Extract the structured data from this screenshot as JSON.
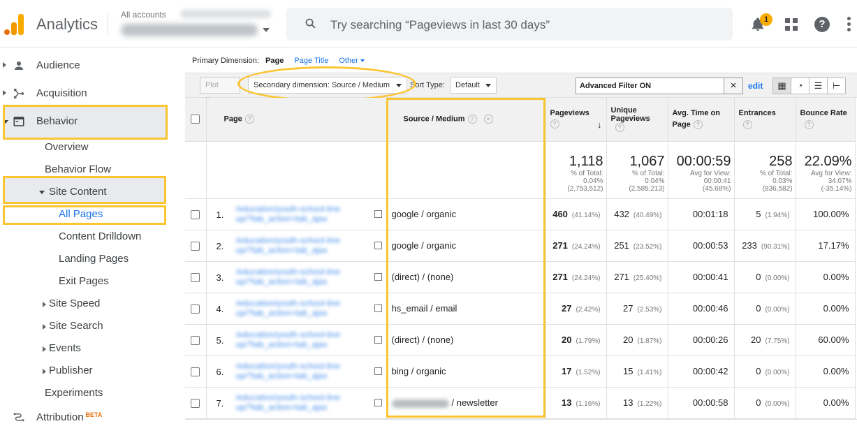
{
  "header": {
    "app_title": "Analytics",
    "account_label": "All accounts",
    "search_placeholder": "Try searching “Pageviews in last 30 days”",
    "notification_count": "1",
    "help_label": "?"
  },
  "sidebar": {
    "audience": "Audience",
    "acquisition": "Acquisition",
    "behavior": "Behavior",
    "overview": "Overview",
    "behavior_flow": "Behavior Flow",
    "site_content": "Site Content",
    "all_pages": "All Pages",
    "content_drilldown": "Content Drilldown",
    "landing_pages": "Landing Pages",
    "exit_pages": "Exit Pages",
    "site_speed": "Site Speed",
    "site_search": "Site Search",
    "events": "Events",
    "publisher": "Publisher",
    "experiments": "Experiments",
    "attribution": "Attribution",
    "beta": "BETA"
  },
  "toolbar": {
    "primary_dimension_label": "Primary Dimension:",
    "primary_page": "Page",
    "primary_page_title": "Page Title",
    "primary_other": "Other",
    "plot_rows": "Plot Rows",
    "secondary_dimension": "Secondary dimension: Source / Medium",
    "sort_type_label": "Sort Type:",
    "sort_default": "Default",
    "advanced_filter": "Advanced Filter ON",
    "clear": "×",
    "edit": "edit"
  },
  "table": {
    "columns": {
      "page": "Page",
      "source_medium": "Source / Medium",
      "pageviews": "Pageviews",
      "unique_pageviews_1": "Unique",
      "unique_pageviews_2": "Pageviews",
      "avg_time_1": "Avg. Time on",
      "avg_time_2": "Page",
      "entrances": "Entrances",
      "bounce_rate": "Bounce Rate"
    },
    "totals": {
      "pageviews": "1,118",
      "pageviews_pct": "% of Total:",
      "pageviews_pct_val": "0.04%",
      "pageviews_total": "(2,753,512)",
      "unique": "1,067",
      "unique_pct": "% of Total:",
      "unique_pct_val": "0.04%",
      "unique_total": "(2,585,213)",
      "avg_time": "00:00:59",
      "avg_time_label": "Avg for View:",
      "avg_time_view": "00:00:41",
      "avg_time_diff": "(45.68%)",
      "entrances": "258",
      "entrances_pct": "% of Total:",
      "entrances_pct_val": "0.03%",
      "entrances_total": "(836,582)",
      "bounce": "22.09%",
      "bounce_label": "Avg for View:",
      "bounce_view": "34.07%",
      "bounce_diff": "(-35.14%)"
    },
    "rows": [
      {
        "idx": "1.",
        "source": "google / organic",
        "pv": "460",
        "pv_pct": "(41.14%)",
        "upv": "432",
        "upv_pct": "(40.49%)",
        "time": "00:01:18",
        "ent": "5",
        "ent_pct": "(1.94%)",
        "bounce": "100.00%"
      },
      {
        "idx": "2.",
        "source": "google / organic",
        "pv": "271",
        "pv_pct": "(24.24%)",
        "upv": "251",
        "upv_pct": "(23.52%)",
        "time": "00:00:53",
        "ent": "233",
        "ent_pct": "(90.31%)",
        "bounce": "17.17%"
      },
      {
        "idx": "3.",
        "source": "(direct) / (none)",
        "pv": "271",
        "pv_pct": "(24.24%)",
        "upv": "271",
        "upv_pct": "(25.40%)",
        "time": "00:00:41",
        "ent": "0",
        "ent_pct": "(0.00%)",
        "bounce": "0.00%"
      },
      {
        "idx": "4.",
        "source": "hs_email / email",
        "pv": "27",
        "pv_pct": "(2.42%)",
        "upv": "27",
        "upv_pct": "(2.53%)",
        "time": "00:00:46",
        "ent": "0",
        "ent_pct": "(0.00%)",
        "bounce": "0.00%"
      },
      {
        "idx": "5.",
        "source": "(direct) / (none)",
        "pv": "20",
        "pv_pct": "(1.79%)",
        "upv": "20",
        "upv_pct": "(1.87%)",
        "time": "00:00:26",
        "ent": "20",
        "ent_pct": "(7.75%)",
        "bounce": "60.00%"
      },
      {
        "idx": "6.",
        "source": "bing / organic",
        "pv": "17",
        "pv_pct": "(1.52%)",
        "upv": "15",
        "upv_pct": "(1.41%)",
        "time": "00:00:42",
        "ent": "0",
        "ent_pct": "(0.00%)",
        "bounce": "0.00%"
      },
      {
        "idx": "7.",
        "source": "/ newsletter",
        "pv": "13",
        "pv_pct": "(1.16%)",
        "upv": "13",
        "upv_pct": "(1.22%)",
        "time": "00:00:58",
        "ent": "0",
        "ent_pct": "(0.00%)",
        "bounce": "0.00%"
      }
    ]
  },
  "colors": {
    "highlight": "#fbc531",
    "link": "#1a73e8",
    "logo_orange": "#e8710a",
    "logo_yellow": "#f9ab00"
  },
  "icons": [
    "search-icon",
    "bell-icon",
    "apps-grid-icon",
    "help-icon",
    "more-vert-icon",
    "person-icon",
    "acquisition-icon",
    "behavior-icon",
    "attribution-icon",
    "open-page-icon",
    "remove-icon"
  ]
}
